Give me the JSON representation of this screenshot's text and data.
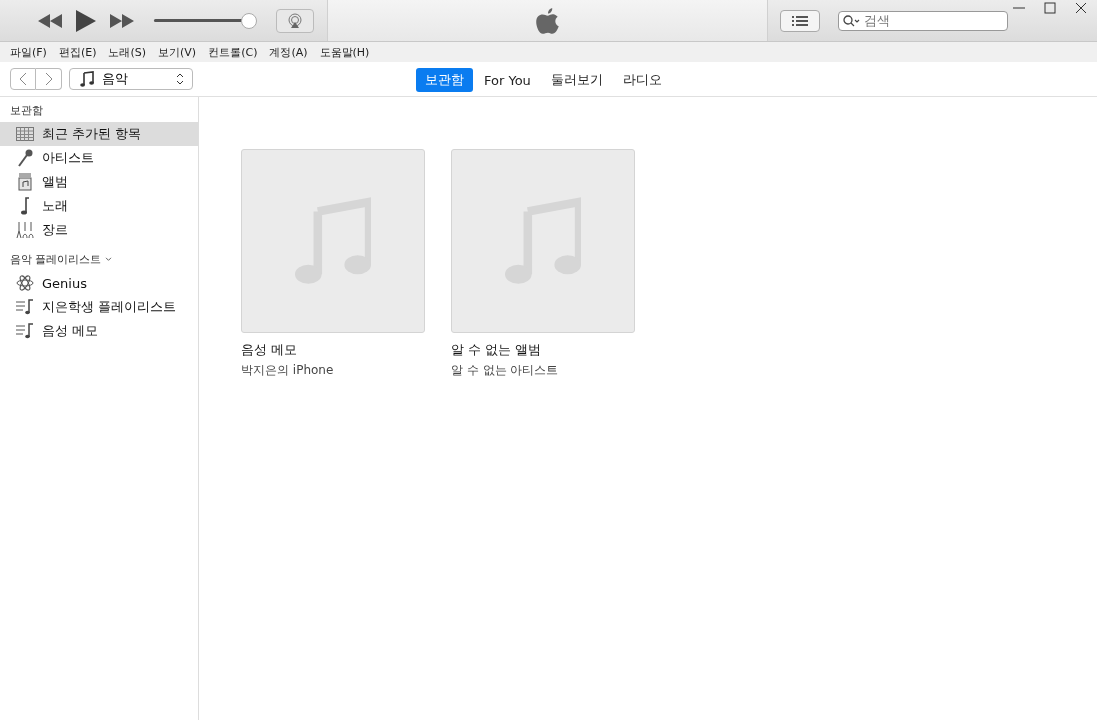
{
  "player": {
    "volume": {
      "level": 0.95
    }
  },
  "search": {
    "placeholder": "검색"
  },
  "menu": [
    "파일(F)",
    "편집(E)",
    "노래(S)",
    "보기(V)",
    "컨트롤(C)",
    "계정(A)",
    "도움말(H)"
  ],
  "media_picker": {
    "value": "음악"
  },
  "tabs": [
    {
      "label": "보관함",
      "selected": true
    },
    {
      "label": "For You",
      "selected": false
    },
    {
      "label": "둘러보기",
      "selected": false
    },
    {
      "label": "라디오",
      "selected": false
    }
  ],
  "sidebar": {
    "sections": [
      {
        "title": "보관함",
        "items": [
          {
            "label": "최근 추가된 항목",
            "kind": "grid",
            "selected": true
          },
          {
            "label": "아티스트",
            "kind": "mic",
            "selected": false
          },
          {
            "label": "앨범",
            "kind": "album",
            "selected": false
          },
          {
            "label": "노래",
            "kind": "note",
            "selected": false
          },
          {
            "label": "장르",
            "kind": "genre",
            "selected": false
          }
        ]
      },
      {
        "title": "음악 플레이리스트",
        "expanded": true,
        "items": [
          {
            "label": "Genius",
            "kind": "atom",
            "selected": false
          },
          {
            "label": "지은학생 플레이리스트",
            "kind": "playlist",
            "selected": false
          },
          {
            "label": "음성 메모",
            "kind": "playlist",
            "selected": false
          }
        ]
      }
    ]
  },
  "albums": [
    {
      "title": "음성 메모",
      "subtitle": "박지은의 iPhone"
    },
    {
      "title": "알 수 없는 앨범",
      "subtitle": "알 수 없는 아티스트"
    }
  ]
}
